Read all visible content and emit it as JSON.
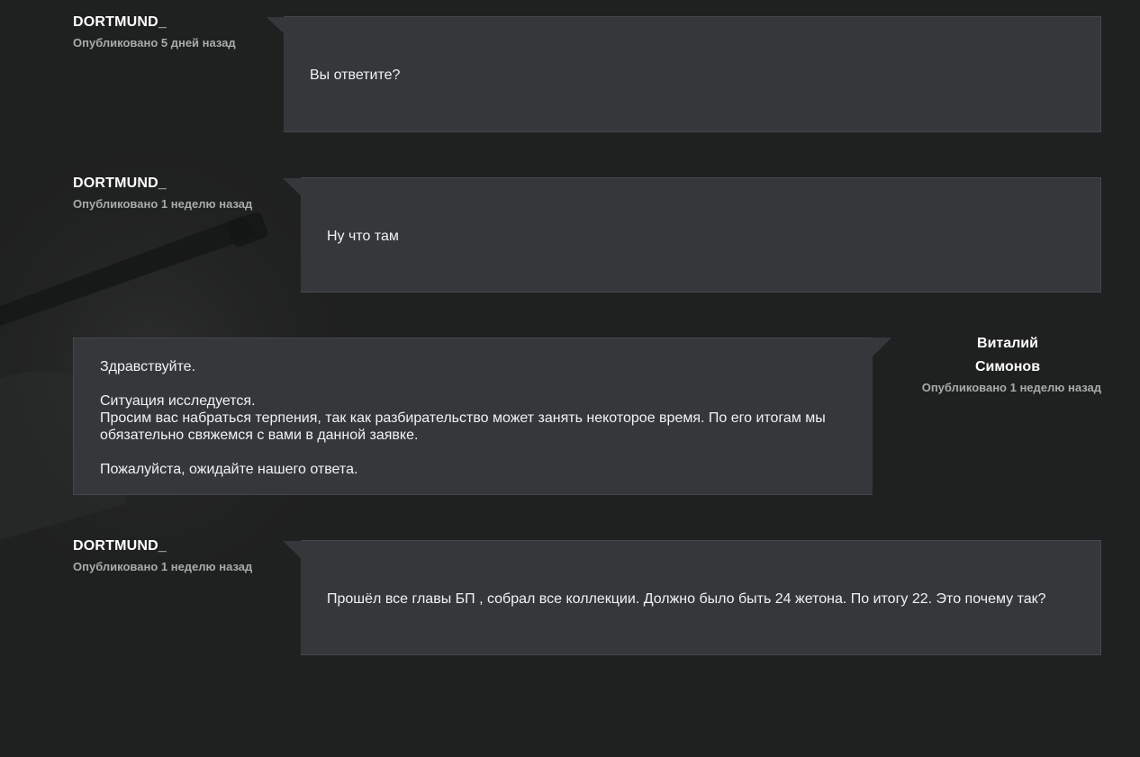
{
  "messages": [
    {
      "author": "DORTMUND_",
      "published": "Опубликовано 5 дней назад",
      "text": "Вы ответите?"
    },
    {
      "author": "DORTMUND_",
      "published": "Опубликовано 1 неделю назад",
      "text": "Ну что там"
    },
    {
      "author_first": "Виталий",
      "author_last": "Симонов",
      "published": "Опубликовано 1 неделю назад",
      "text": "Здравствуйте.\n\nСитуация исследуется.\nПросим вас набраться терпения, так как разбирательство может занять некоторое время. По его итогам мы обязательно свяжемся с вами в данной заявке.\n\nПожалуйста, ожидайте нашего ответа."
    },
    {
      "author": "DORTMUND_",
      "published": "Опубликовано 1 неделю назад",
      "text": "Прошёл все главы БП , собрал все коллекции. Должно было быть 24 жетона. По итогу 22. Это почему так?"
    }
  ],
  "colors": {
    "background": "#1f2020",
    "bubble": "#35383a",
    "bubble_border": "#45484a",
    "meta_text": "#a9aaaa"
  }
}
